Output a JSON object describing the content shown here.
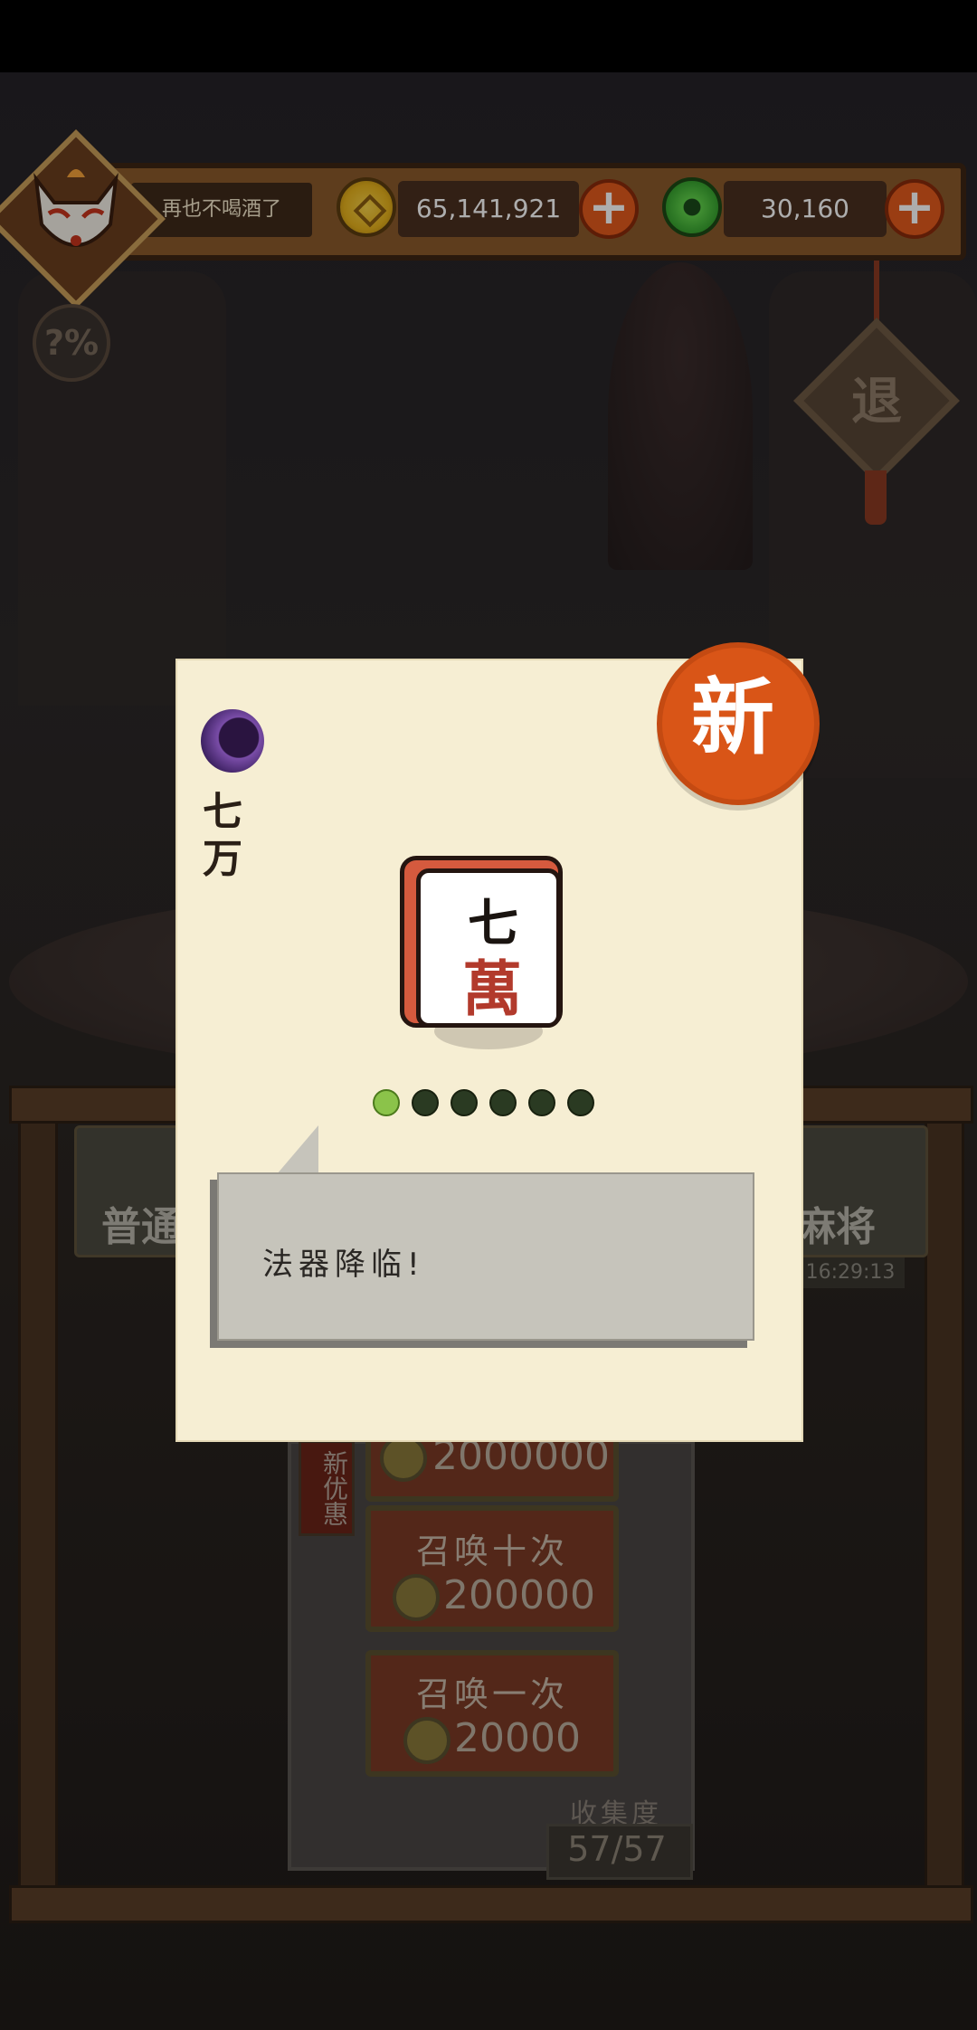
{
  "player": {
    "name": "再也不喝酒了"
  },
  "resources": {
    "coins": "65,141,921",
    "jade": "30,160"
  },
  "icons": {
    "help": "?%",
    "exit": "退",
    "add": "+"
  },
  "background": {
    "left_button_label": "普通",
    "right_button_label": "麻将",
    "timer": "16:29:13",
    "discount_tag": "新优惠",
    "summon_top_cost": "2000000",
    "summon_ten": {
      "label": "召唤十次",
      "cost": "200000"
    },
    "summon_one": {
      "label": "召唤一次",
      "cost": "20000"
    },
    "collection_label": "收集度",
    "collection_value": "57/57"
  },
  "card": {
    "new_badge": "新",
    "tile_name": "七万",
    "tile_char_top": "七",
    "tile_char_bottom": "萬",
    "level": {
      "filled": 1,
      "total": 6
    },
    "message": "法器降临!"
  },
  "colors": {
    "accent_orange": "#e35a1d",
    "jade_green": "#3db23a",
    "card_bg": "#f6eed3"
  }
}
